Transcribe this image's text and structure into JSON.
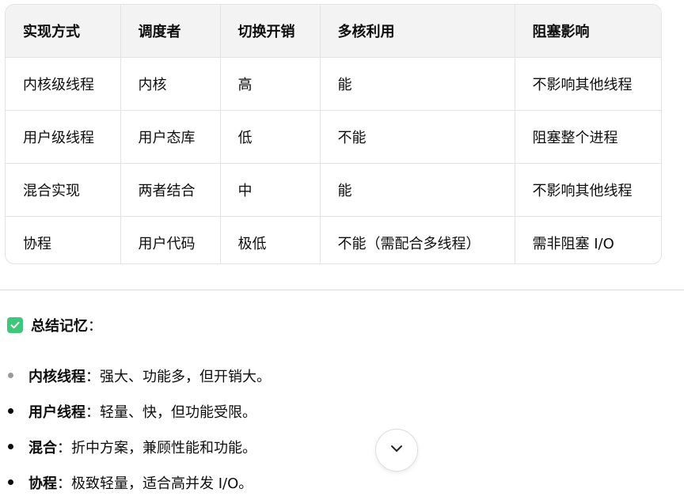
{
  "table": {
    "headers": [
      "实现方式",
      "调度者",
      "切换开销",
      "多核利用",
      "阻塞影响"
    ],
    "rows": [
      [
        "内核级线程",
        "内核",
        "高",
        "能",
        "不影响其他线程"
      ],
      [
        "用户级线程",
        "用户态库",
        "低",
        "不能",
        "阻塞整个进程"
      ],
      [
        "混合实现",
        "两者结合",
        "中",
        "能",
        "不影响其他线程"
      ],
      [
        "协程",
        "用户代码",
        "极低",
        "不能（需配合多线程）",
        "需非阻塞 I/O"
      ]
    ]
  },
  "summary": {
    "icon": "check-mark-icon",
    "icon_color": "#3ec77a",
    "title": "总结记忆",
    "colon": "：",
    "items": [
      {
        "term": "内核线程",
        "text": "：强大、功能多，但开销大。"
      },
      {
        "term": "用户线程",
        "text": "：轻量、快，但功能受限。"
      },
      {
        "term": "混合",
        "text": "：折中方案，兼顾性能和功能。"
      },
      {
        "term": "协程",
        "text": "：极致轻量，适合高并发 I/O。"
      }
    ]
  },
  "scroll_button": {
    "icon": "chevron-down-icon"
  }
}
